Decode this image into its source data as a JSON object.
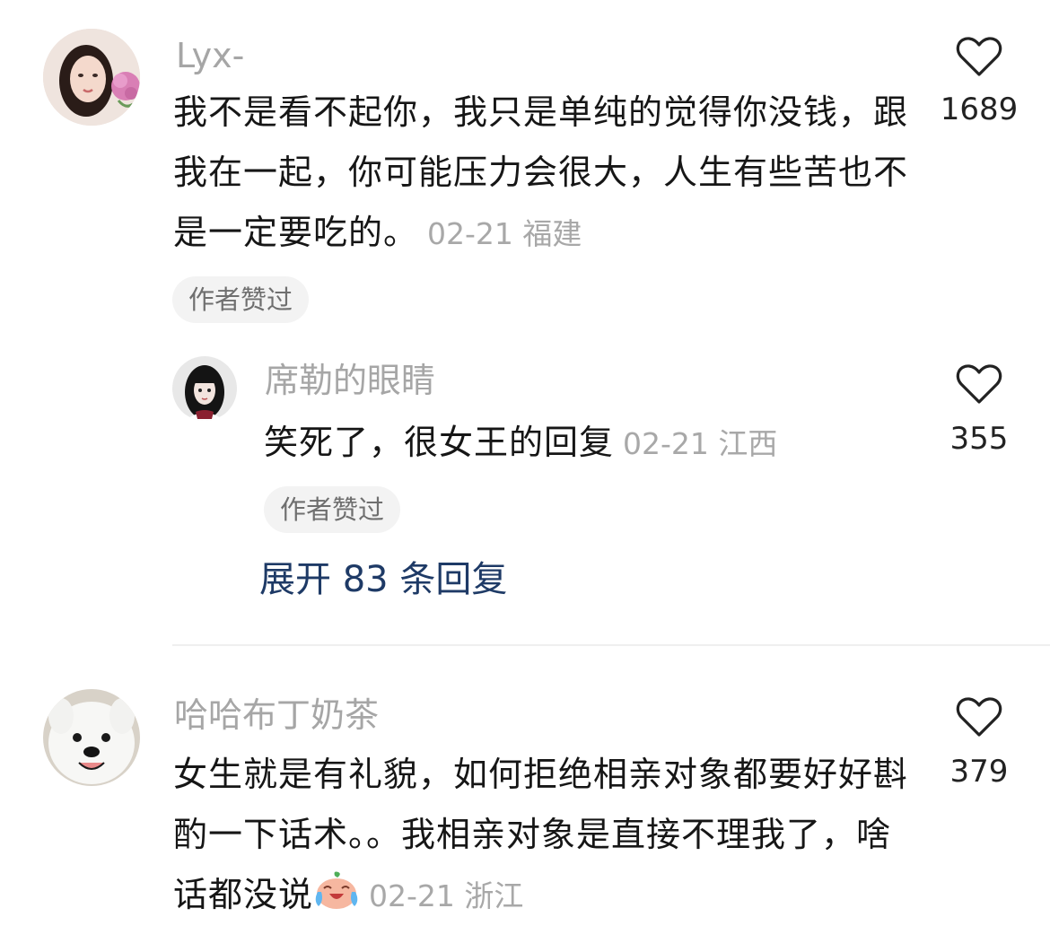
{
  "comments": [
    {
      "username": "Lyx-",
      "text": "我不是看不起你，我只是单纯的觉得你没钱，跟我在一起，你可能压力会很大，人生有些苦也不是一定要吃的。",
      "date": "02-21",
      "location": "福建",
      "badge": "作者赞过",
      "likes": "1689",
      "reply": {
        "username": "席勒的眼睛",
        "text": "笑死了，很女王的回复",
        "date": "02-21",
        "location": "江西",
        "badge": "作者赞过",
        "likes": "355"
      },
      "expand_label": "展开 83 条回复"
    },
    {
      "username": "哈哈布丁奶茶",
      "text": "女生就是有礼貌，如何拒绝相亲对象都要好好斟酌一下话术。。我相亲对象是直接不理我了，啥话都没说",
      "date": "02-21",
      "location": "浙江",
      "likes": "379"
    }
  ],
  "icons": {
    "like": "heart-outline-icon",
    "emoji": "crying-laughing-emoji-icon"
  },
  "colors": {
    "username": "#a6a6a6",
    "meta": "#a8a8a8",
    "expand_link": "#1e3a66",
    "badge_bg": "#f3f3f3"
  }
}
